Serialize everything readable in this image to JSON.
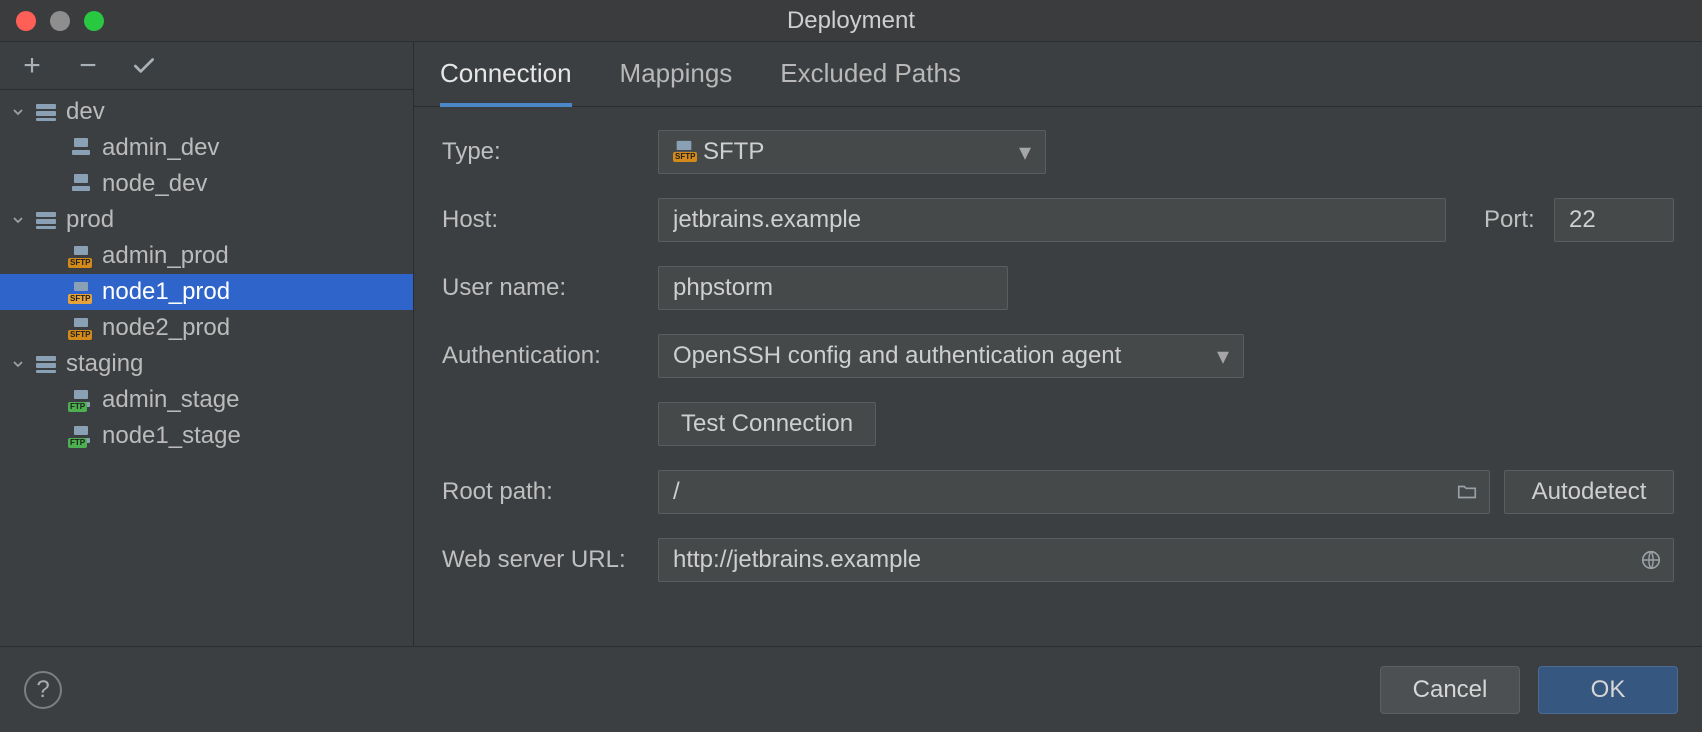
{
  "window": {
    "title": "Deployment"
  },
  "toolbar": {
    "add": "+",
    "remove": "−",
    "apply": "✓"
  },
  "tree": {
    "groups": [
      {
        "name": "dev",
        "items": [
          {
            "label": "admin_dev",
            "kind": "local"
          },
          {
            "label": "node_dev",
            "kind": "local"
          }
        ]
      },
      {
        "name": "prod",
        "items": [
          {
            "label": "admin_prod",
            "kind": "sftp"
          },
          {
            "label": "node1_prod",
            "kind": "sftp",
            "selected": true
          },
          {
            "label": "node2_prod",
            "kind": "sftp"
          }
        ]
      },
      {
        "name": "staging",
        "items": [
          {
            "label": "admin_stage",
            "kind": "ftp"
          },
          {
            "label": "node1_stage",
            "kind": "ftp"
          }
        ]
      }
    ]
  },
  "tabs": {
    "items": [
      "Connection",
      "Mappings",
      "Excluded Paths"
    ],
    "active": 0
  },
  "form": {
    "type_label": "Type:",
    "type_value": "SFTP",
    "host_label": "Host:",
    "host_value": "jetbrains.example",
    "port_label": "Port:",
    "port_value": "22",
    "user_label": "User name:",
    "user_value": "phpstorm",
    "auth_label": "Authentication:",
    "auth_value": "OpenSSH config and authentication agent",
    "test_button": "Test Connection",
    "root_label": "Root path:",
    "root_value": "/",
    "autodetect_button": "Autodetect",
    "weburl_label": "Web server URL:",
    "weburl_value": "http://jetbrains.example"
  },
  "footer": {
    "cancel": "Cancel",
    "ok": "OK"
  }
}
